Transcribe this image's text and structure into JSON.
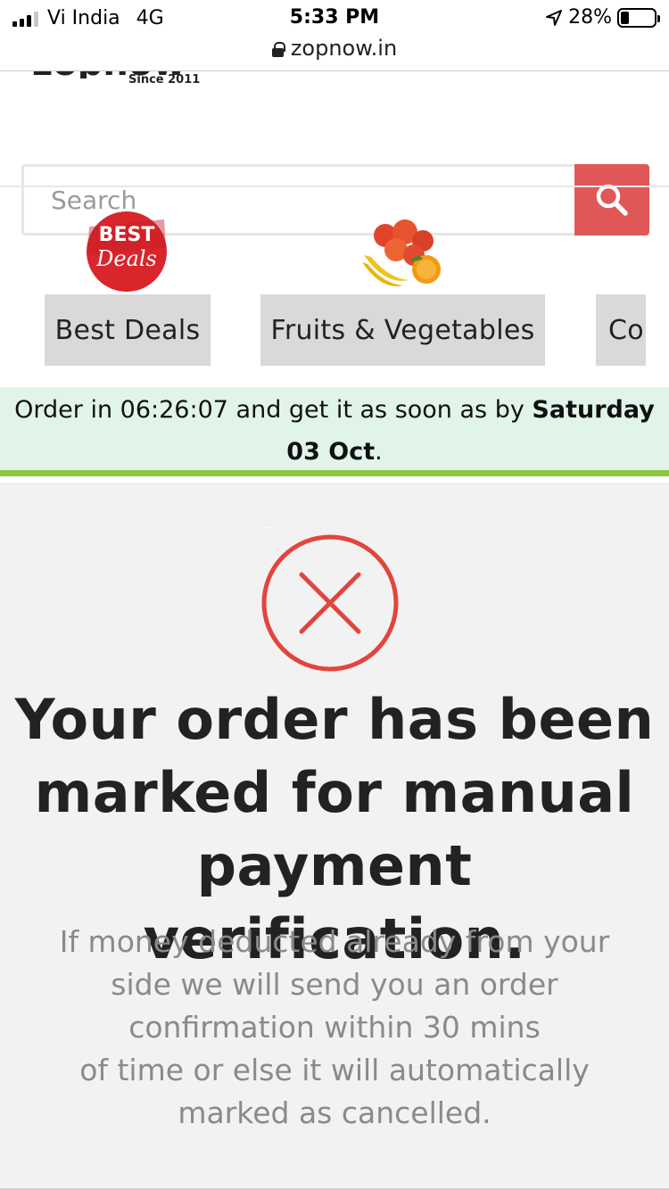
{
  "status_bar": {
    "carrier": "Vi India",
    "network": "4G",
    "time": "5:33 PM",
    "battery": "28%",
    "battery_level": 0.28
  },
  "browser": {
    "url": "zopnow.in"
  },
  "header": {
    "since": "Since 2011",
    "search": {
      "placeholder": "Search",
      "value": ""
    }
  },
  "categories": [
    {
      "label": "Best Deals",
      "icon": "best-deals-badge"
    },
    {
      "label": "Fruits & Vegetables",
      "icon": "fruits-basket"
    },
    {
      "label": "Co",
      "icon": ""
    }
  ],
  "best_deals_badge": {
    "line1": "BEST",
    "line2": "Deals"
  },
  "delivery": {
    "prefix": "Order in",
    "countdown": "06:26:07",
    "middle": "and get it as soon as by",
    "date": "Saturday 03 Oct",
    "suffix": "."
  },
  "result": {
    "headline": "Your order has been marked for manual payment verification.",
    "message_lines": [
      "If money deducted already from your",
      "side we will send you an order",
      "confirmation within 30 mins",
      "of time or else it will automatically",
      "marked as cancelled."
    ]
  },
  "colors": {
    "accent_red": "#e05757",
    "error_red": "#e2453e",
    "banner_bg": "#e0f4ea",
    "banner_border": "#8dc63f",
    "category_bg": "#d9d9d9"
  }
}
